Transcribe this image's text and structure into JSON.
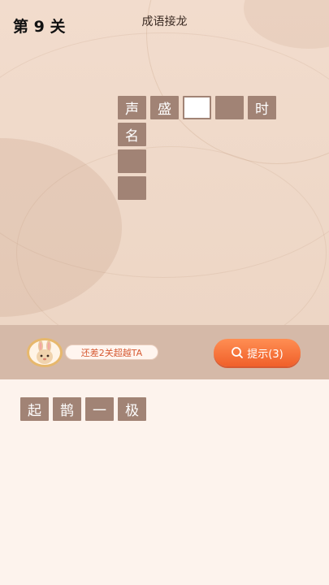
{
  "header": {
    "level": "第 9 关",
    "title": "成语接龙"
  },
  "grid": {
    "cells": [
      {
        "text": "声",
        "state": "filled"
      },
      {
        "text": "盛",
        "state": "filled"
      },
      {
        "text": "",
        "state": "active"
      },
      {
        "text": "",
        "state": "empty"
      },
      {
        "text": "时",
        "state": "filled"
      },
      {
        "text": "名",
        "state": "filled"
      },
      {
        "text": "",
        "state": "empty"
      },
      {
        "text": "",
        "state": "empty"
      }
    ]
  },
  "progress": {
    "message": "还差2关超越TA"
  },
  "hint": {
    "label": "提示(3)"
  },
  "options": [
    "起",
    "鹊",
    "一",
    "极"
  ],
  "colors": {
    "tile": "#a18375",
    "accent": "#f0602a",
    "pill_text": "#d65a33"
  }
}
